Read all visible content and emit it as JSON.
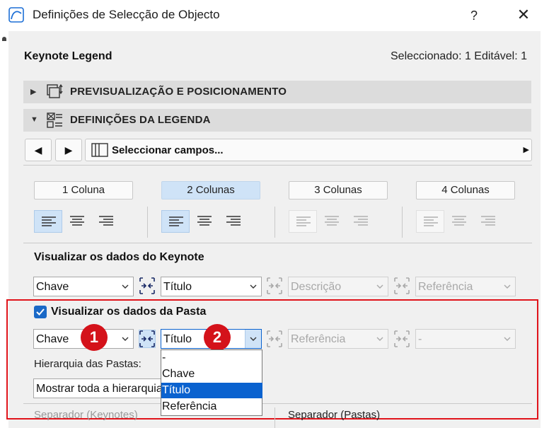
{
  "window": {
    "title": "Definições de Selecção de Objecto",
    "help": "?",
    "close": "✕"
  },
  "header": {
    "element_name": "Keynote Legend",
    "selection_status": "Seleccionado: 1 Editável: 1"
  },
  "sections": [
    {
      "label": "PREVISUALIZAÇÃO E POSICIONAMENTO",
      "expanded": false
    },
    {
      "label": "DEFINIÇÕES DA LEGENDA",
      "expanded": true
    }
  ],
  "fields_bar": {
    "prev": "◀",
    "next": "▶",
    "label": "Seleccionar campos...",
    "arrow": "▶"
  },
  "columns": {
    "options": [
      "1 Coluna",
      "2 Colunas",
      "3 Colunas",
      "4 Colunas"
    ],
    "selected": "2 Colunas"
  },
  "keynote_data": {
    "heading": "Visualizar os dados do Keynote",
    "fields": [
      "Chave",
      "Título",
      "Descrição",
      "Referência"
    ]
  },
  "folder_data": {
    "heading": "Visualizar os dados da Pasta",
    "checked": true,
    "fields": [
      "Chave",
      "Título",
      "Referência",
      "-"
    ],
    "hierarchy_label": "Hierarquia das Pastas:",
    "hierarchy_value": "Mostrar toda a hierarquia"
  },
  "dropdown": {
    "options": [
      "-",
      "Chave",
      "Título",
      "Referência"
    ],
    "selected": "Título"
  },
  "callouts": [
    "1",
    "2"
  ],
  "separators": {
    "keynotes": "Separador (Keynotes)",
    "folders": "Separador (Pastas)"
  },
  "colors": {
    "accent": "#0a62cf",
    "selected_tab": "#cfe3f7",
    "highlight_border": "#e0141b",
    "badge": "#d4121a"
  }
}
